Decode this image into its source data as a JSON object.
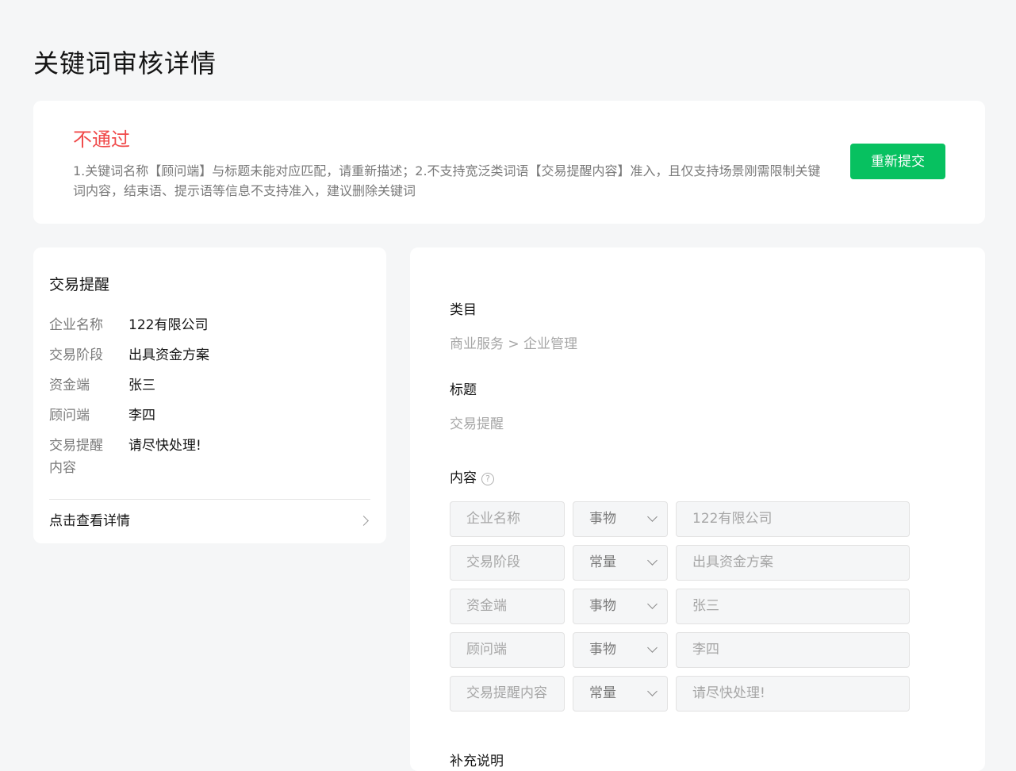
{
  "page": {
    "title": "关键词审核详情"
  },
  "status": {
    "title": "不通过",
    "reason": "1.关键词名称【顾问端】与标题未能对应匹配，请重新描述；2.不支持宽泛类词语【交易提醒内容】准入，且仅支持场景刚需限制关键词内容，结束语、提示语等信息不支持准入，建议删除关键词",
    "resubmit_label": "重新提交",
    "color": "#f04a4a",
    "button_color": "#07c160"
  },
  "preview": {
    "title": "交易提醒",
    "rows": [
      {
        "label": "企业名称",
        "value": "122有限公司"
      },
      {
        "label": "交易阶段",
        "value": "出具资金方案"
      },
      {
        "label": "资金端",
        "value": "张三"
      },
      {
        "label": "顾问端",
        "value": "李四"
      },
      {
        "label": "交易提醒内容",
        "value": "请尽快处理!"
      }
    ],
    "view_detail_label": "点击查看详情"
  },
  "detail": {
    "category_label": "类目",
    "category_value": "商业服务 > 企业管理",
    "title_label": "标题",
    "title_value": "交易提醒",
    "content_label": "内容",
    "help_icon": "?",
    "content_rows": [
      {
        "name": "企业名称",
        "type": "事物",
        "value": "122有限公司"
      },
      {
        "name": "交易阶段",
        "type": "常量",
        "value": "出具资金方案"
      },
      {
        "name": "资金端",
        "type": "事物",
        "value": "张三"
      },
      {
        "name": "顾问端",
        "type": "事物",
        "value": "李四"
      },
      {
        "name": "交易提醒内容",
        "type": "常量",
        "value": "请尽快处理!"
      }
    ],
    "supplement_label": "补充说明"
  }
}
